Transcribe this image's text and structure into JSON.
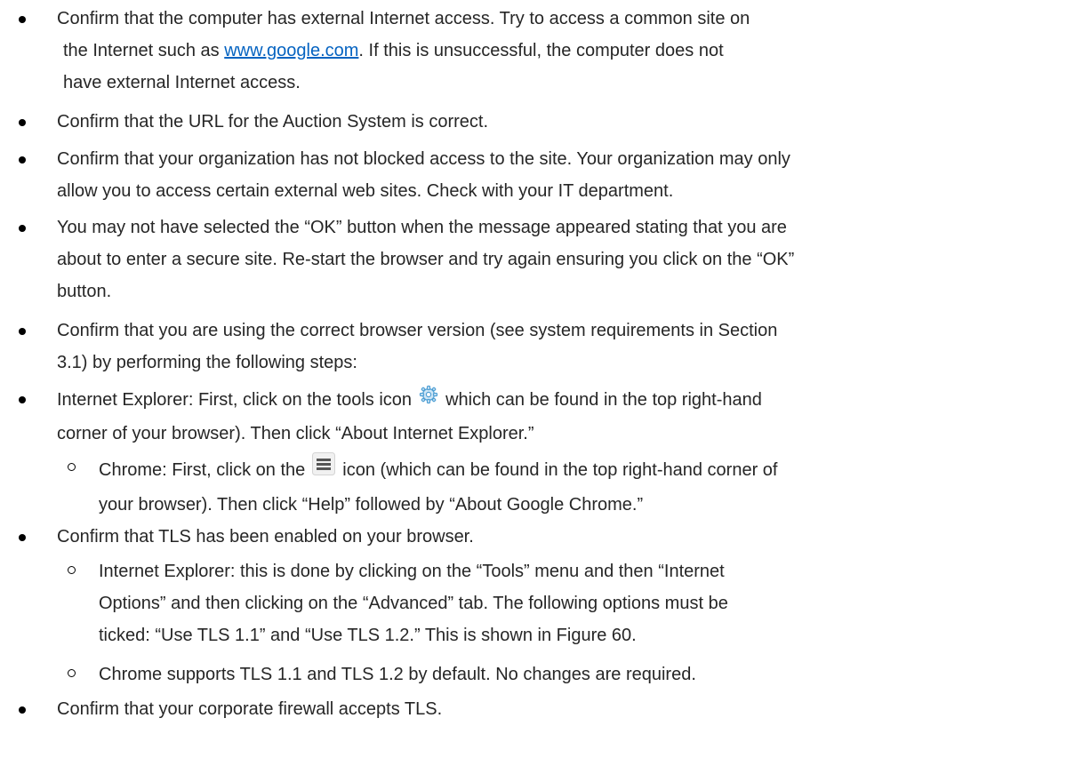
{
  "bullets": [
    {
      "l1a": "Confirm that the computer has external Internet access.  Try to access a common site on",
      "l2a": "the Internet such as ",
      "l2link": "www.google.com",
      "l2b": ".  If this is unsuccessful, the computer does not",
      "l3a": "have external Internet access."
    },
    {
      "l1a": "Confirm that the URL for the Auction System is correct."
    },
    {
      "l1a": "Confirm that your organization has not blocked access to the site.  Your organization may only",
      "l2a": "allow you to access certain external web sites.  Check with your IT department."
    },
    {
      "l1a": "You may not have selected the “OK” button when the message appeared stating that you are",
      "l2a": "about to enter a secure site.  Re-start the browser and try again ensuring you click on the “OK”",
      "l3a": "button."
    },
    {
      "l1a": "Confirm that you are using the correct browser version (see system requirements in Section",
      "l2a": "3.1) by performing the following steps:"
    },
    {
      "l1a": "Internet Explorer:  First, click on the tools icon",
      "l1b": "which can be found in the top right-hand",
      "l2a": "corner of your browser).  Then click “About Internet Explorer.”"
    },
    {
      "l1a": "Chrome:  First, click on the",
      "l1b": "icon (which can be found in the top right-hand corner of",
      "l2a": "your browser).  Then click “Help” followed by “About Google Chrome.”"
    },
    {
      "l1a": "Confirm that TLS has been enabled on your browser."
    },
    {
      "l1a": "Internet Explorer: this is done by clicking on the “Tools” menu and then “Internet",
      "l2a": "Options” and then clicking on the “Advanced” tab.  The following options must be",
      "l3a": "ticked: “Use TLS 1.1” and “Use TLS 1.2.” This is shown in Figure 60."
    },
    {
      "l1a": "Chrome supports TLS 1.1 and TLS 1.2 by default.  No changes are required."
    },
    {
      "l1a": "Confirm that your corporate firewall accepts TLS."
    }
  ],
  "icons": {
    "tools_icon": "gear-icon",
    "chrome_menu_icon": "hamburger-menu-icon"
  }
}
